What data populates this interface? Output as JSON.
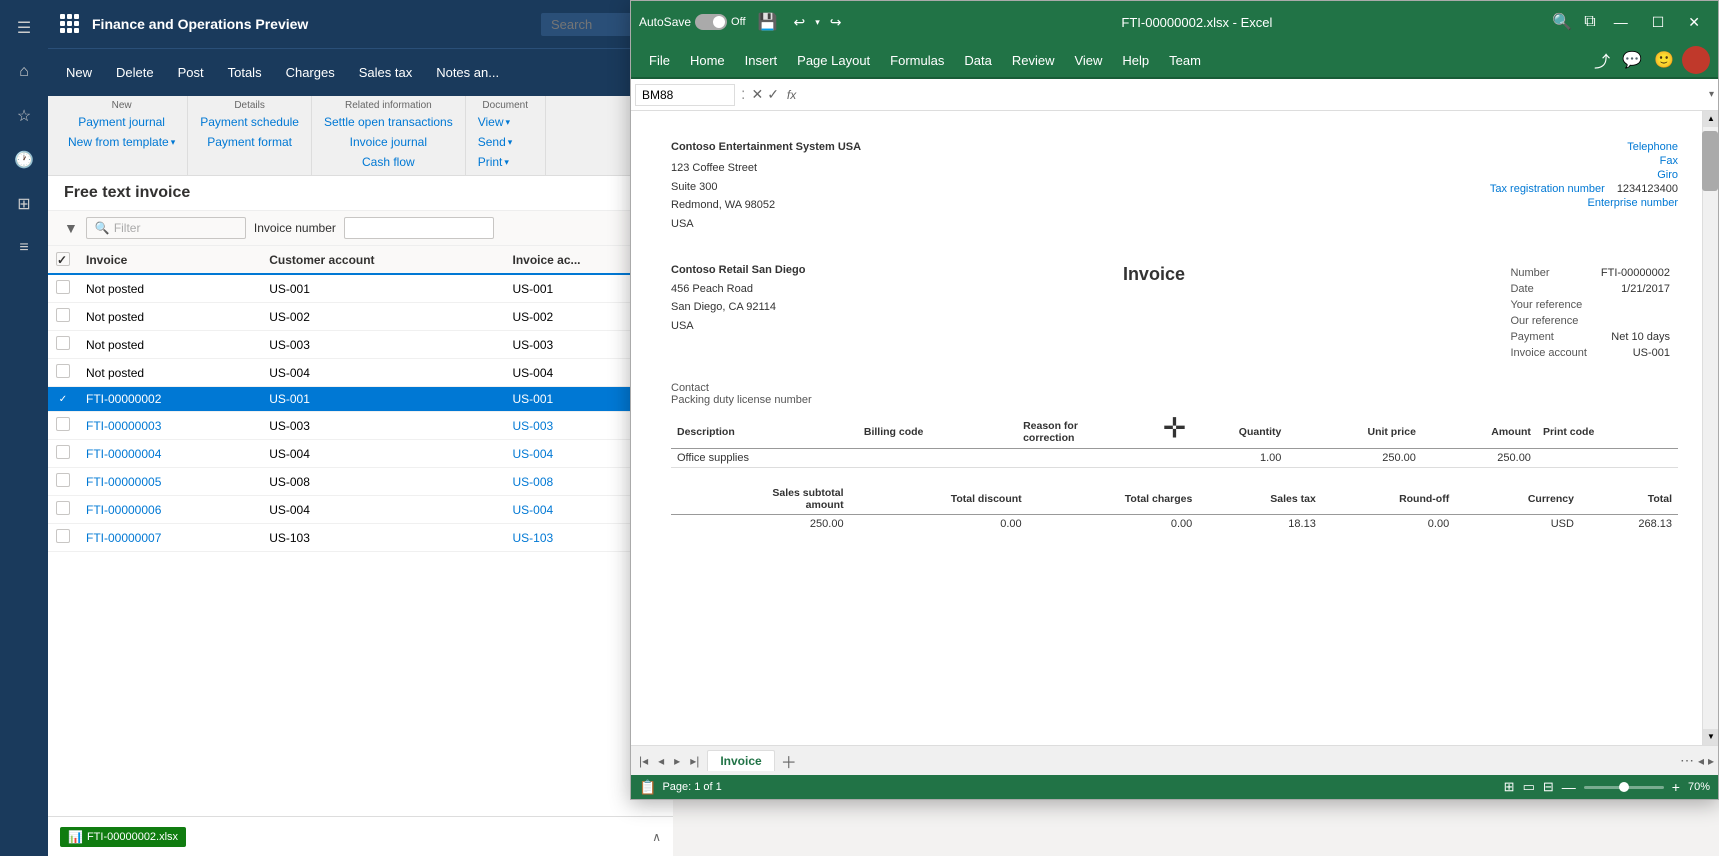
{
  "app": {
    "title": "Finance and Operations Preview",
    "search_placeholder": "Search"
  },
  "nav": {
    "buttons": [
      "New",
      "Delete",
      "Post",
      "Totals",
      "Charges",
      "Sales tax",
      "Notes an..."
    ]
  },
  "ribbon": {
    "groups": [
      {
        "label": "New",
        "items": [
          "Payment journal",
          "New from template ▾"
        ]
      },
      {
        "label": "Details",
        "items": [
          "Payment schedule",
          "Payment format"
        ]
      },
      {
        "label": "Related information",
        "items": [
          "Settle open transactions",
          "Invoice journal",
          "Cash flow"
        ]
      },
      {
        "label": "Document",
        "items": [
          "View ▾",
          "Send ▾",
          "Print ▾"
        ]
      }
    ]
  },
  "list": {
    "title": "Free text invoice",
    "filter_placeholder": "Filter",
    "invoice_number_label": "Invoice number",
    "columns": [
      "Invoice",
      "Customer account",
      "Invoice ac..."
    ],
    "rows": [
      {
        "invoice": "Not posted",
        "customer": "US-001",
        "invoice_acc": "US-001",
        "selected": false,
        "is_link": false
      },
      {
        "invoice": "Not posted",
        "customer": "US-002",
        "invoice_acc": "US-002",
        "selected": false,
        "is_link": false
      },
      {
        "invoice": "Not posted",
        "customer": "US-003",
        "invoice_acc": "US-003",
        "selected": false,
        "is_link": false
      },
      {
        "invoice": "Not posted",
        "customer": "US-004",
        "invoice_acc": "US-004",
        "selected": false,
        "is_link": false
      },
      {
        "invoice": "FTI-00000002",
        "customer": "US-001",
        "invoice_acc": "US-001",
        "selected": true,
        "is_link": true
      },
      {
        "invoice": "FTI-00000003",
        "customer": "US-003",
        "invoice_acc": "US-003",
        "selected": false,
        "is_link": true
      },
      {
        "invoice": "FTI-00000004",
        "customer": "US-004",
        "invoice_acc": "US-004",
        "selected": false,
        "is_link": true
      },
      {
        "invoice": "FTI-00000005",
        "customer": "US-008",
        "invoice_acc": "US-008",
        "selected": false,
        "is_link": true
      },
      {
        "invoice": "FTI-00000006",
        "customer": "US-004",
        "invoice_acc": "US-004",
        "selected": false,
        "is_link": true
      },
      {
        "invoice": "FTI-00000007",
        "customer": "US-103",
        "invoice_acc": "US-103",
        "selected": false,
        "is_link": true
      }
    ]
  },
  "taskbar": {
    "file_label": "FTI-00000002.xlsx",
    "file_icon": "xlsx"
  },
  "excel": {
    "autosave_label": "AutoSave",
    "toggle_state": "Off",
    "title": "FTI-00000002.xlsx  -  Excel",
    "name_box": "BM88",
    "menubar": {
      "items": [
        "File",
        "Home",
        "Insert",
        "Page Layout",
        "Formulas",
        "Data",
        "Review",
        "View",
        "Help",
        "Team"
      ]
    },
    "invoice_doc": {
      "from_name": "Contoso Entertainment System USA",
      "from_address": "123 Coffee Street\nSuite 300\nRedmond, WA 98052\nUSA",
      "links": [
        "Telephone",
        "Fax",
        "Giro",
        "Tax registration number",
        "Enterprise number"
      ],
      "tax_reg_number": "1234123400",
      "to_name": "Contoso Retail San Diego",
      "to_address": "456 Peach Road\nSan Diego, CA 92114\nUSA",
      "invoice_title": "Invoice",
      "meta": [
        {
          "label": "Number",
          "value": "FTI-00000002"
        },
        {
          "label": "Date",
          "value": "1/21/2017"
        },
        {
          "label": "Your reference",
          "value": ""
        },
        {
          "label": "Our reference",
          "value": ""
        },
        {
          "label": "Payment",
          "value": "Net 10 days"
        },
        {
          "label": "Invoice account",
          "value": "US-001"
        }
      ],
      "contact_label": "Contact",
      "packing_label": "Packing duty license number",
      "table_headers": [
        "Description",
        "Billing code",
        "Reason for correction",
        "Quantity",
        "Unit price",
        "Amount",
        "Print code"
      ],
      "table_rows": [
        {
          "desc": "Office supplies",
          "billing": "",
          "reason": "",
          "qty": "1.00",
          "unit_price": "250.00",
          "amount": "250.00",
          "print": ""
        }
      ],
      "summary_headers": [
        "Sales subtotal amount",
        "Total discount",
        "Total charges",
        "Sales tax",
        "Round-off",
        "Currency",
        "Total"
      ],
      "summary_row": [
        "250.00",
        "0.00",
        "0.00",
        "18.13",
        "0.00",
        "USD",
        "268.13"
      ]
    },
    "sheet_tab": "Invoice",
    "status": {
      "page": "Page: 1 of 1",
      "zoom": "70%"
    }
  }
}
